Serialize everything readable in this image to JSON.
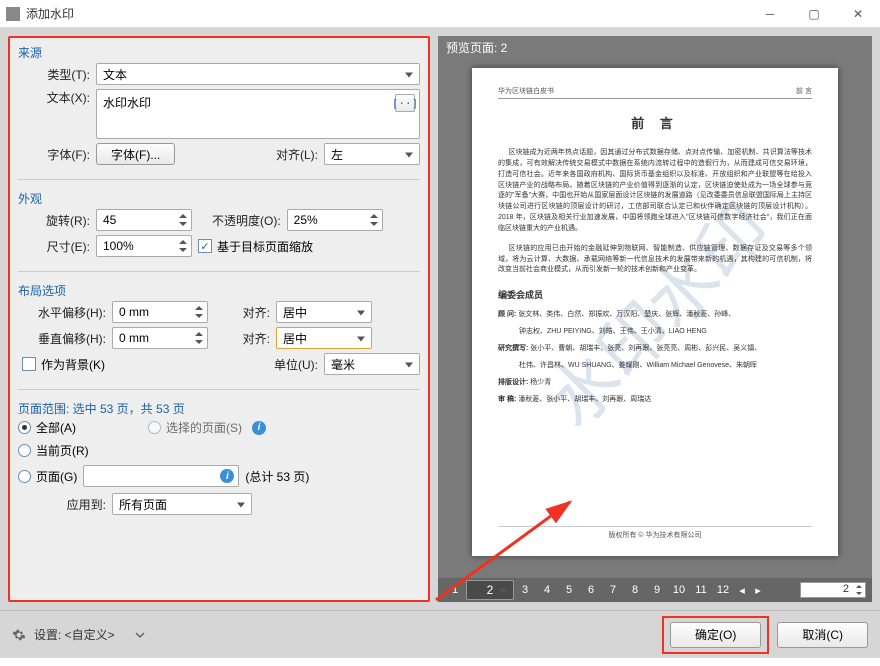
{
  "titlebar": {
    "title": "添加水印"
  },
  "source": {
    "title": "来源",
    "type_label": "类型(T):",
    "type_value": "文本",
    "text_label": "文本(X):",
    "text_value": "水印水印",
    "font_label": "字体(F):",
    "font_btn": "字体(F)...",
    "align_label": "对齐(L):",
    "align_value": "左"
  },
  "appearance": {
    "title": "外观",
    "rotate_label": "旋转(R):",
    "rotate_value": "45",
    "opacity_label": "不透明度(O):",
    "opacity_value": "25%",
    "scale_label": "尺寸(E):",
    "scale_value": "100%",
    "fit_checkbox": "基于目标页面缩放"
  },
  "layout": {
    "title": "布局选项",
    "hoff_label": "水平偏移(H):",
    "hoff_value": "0 mm",
    "voff_label": "垂直偏移(H):",
    "voff_value": "0 mm",
    "align1_label": "对齐:",
    "align1_value": "居中",
    "align2_label": "对齐:",
    "align2_value": "居中",
    "asbg_label": "作为背景(K)",
    "unit_label": "单位(U):",
    "unit_value": "毫米"
  },
  "pagerange": {
    "title": "页面范围: 选中 53 页，共 53 页",
    "all": "全部(A)",
    "selected": "选择的页面(S)",
    "current": "当前页(R)",
    "pages": "页面(G)",
    "total_hint": "(总计 53 页)",
    "apply_label": "应用到:",
    "apply_value": "所有页面"
  },
  "preview": {
    "header": "预览页面: 2",
    "doc": {
      "hdr_left": "华为区块链白皮书",
      "hdr_right": "前 言",
      "h1": "前 言",
      "p1": "区块链成为近两年热点话题，因其通过分布式数据存储、点对点传输、加密机制、共识算法等技术的集成，可有效解决传统交易模式中数据在系统内流转过程中的造假行为，从而建成可信交易环境，打造可信社会。近年来各国政府机构、国际货币基金组织以及标准、开放组织和产业联盟等在给投入区块链产业的战略布局。随着区块链的产业价值得到逐渐的认定，区块链迫使处成为一场全球参与竞逐的\"军备\"大赛，中国也开始从国家层面设计区块链的发展道路（见改委委员信息联盟国际局上主持区块链公司进行区块链的顶层设计的研讨，工信部司联合认定已和伙伴确定区块链的顶层设计机构）。2018 年，区块链及相关行业加速发展，中国将领跑全球进入\"区块链可信数字经济社会\"，我们正在面临区块链重大的产业机遇。",
      "p2": "区块链的应用已由开始的金融延伸到物联网、智能制造、供应链管理、数据存证及交易等多个领域，将为云计算、大数据、承载网络等新一代信息技术的发展带来新的机遇，其构建的可信机制，将改变当前社会商业模式，从而引发新一轮的技术创新和产业变革。",
      "sub": "编委会成员",
      "l1b": "顾 问:",
      "l1": " 张文林、类伟、白然、郑振欢、万汉阳、楚庆、张辉、潘秋菱、孙峰、",
      "l1c": "钟志权、ZHU PEIYING、刘皓、王伟、王小清、LIAO HENG",
      "l2b": "研究撰写:",
      "l2": " 张小平、曹朝、胡瑞丰、张亮、刘再跟、张亮亮、周彬、彭兴民、吴义镇、",
      "l2c": "杜伟、许昌林、WU SHUANG、姜耀刚、William Michael Genovese、朱朝晖",
      "l3b": "排版设计:",
      "l3": " 杨少青",
      "l4b": "审 稿:",
      "l4": " 潘秋菱、张小平、胡瑞丰、刘再跟、周瑞达",
      "copyright": "版权所有 © 华为技术有限公司",
      "watermark": "水印水印"
    },
    "pages": [
      "1",
      "2",
      "3",
      "4",
      "5",
      "6",
      "7",
      "8",
      "9",
      "10",
      "11",
      "12"
    ],
    "jump": "2"
  },
  "footer": {
    "settings": "设置: <自定义>",
    "ok": "确定(O)",
    "cancel": "取消(C)"
  }
}
